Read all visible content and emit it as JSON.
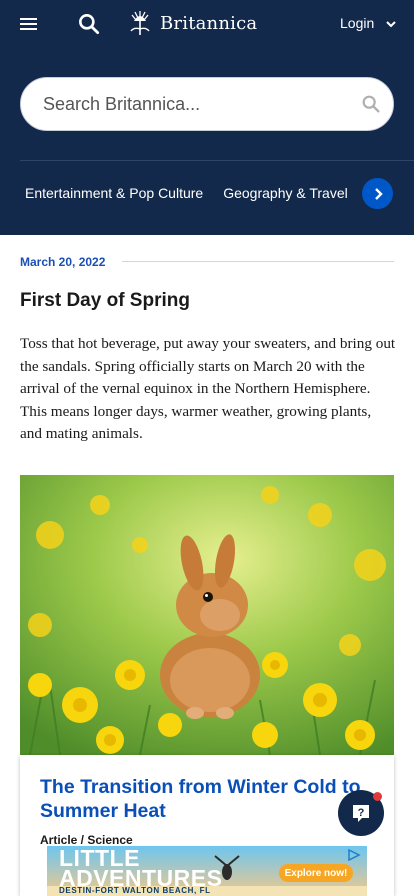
{
  "header": {
    "brand": "Britannica",
    "login_label": "Login",
    "icons": [
      "hamburger-menu-icon",
      "search-icon",
      "thistle-logo-icon",
      "chevron-down-icon"
    ]
  },
  "search": {
    "placeholder": "Search Britannica..."
  },
  "categories": {
    "items": [
      "Entertainment & Pop Culture",
      "Geography & Travel"
    ],
    "next_icon": "chevron-right-icon"
  },
  "article": {
    "date": "March 20, 2022",
    "title": "First Day of Spring",
    "body": "Toss that hot beverage, put away your sweaters, and bring out the sandals. Spring officially starts on March 20 with the arrival of the vernal equinox in the Northern Hemisphere. This means longer days, warmer weather, growing plants, and mating animals."
  },
  "card": {
    "title": "The Transition from Winter Cold to Summer Heat",
    "meta": "Article / Science",
    "image": "rabbit-in-dandelion-field"
  },
  "help": {
    "icon": "question-help-icon"
  },
  "ad": {
    "title": "LITTLE ADVENTURES",
    "subtitle": "DESTIN-FORT WALTON BEACH, FL",
    "cta": "Explore now!",
    "choice_icon": "adchoices-icon"
  },
  "colors": {
    "navy": "#13294b",
    "accent_blue": "#0057c8",
    "link_blue": "#0a4fb8",
    "alert_red": "#e03a3a"
  }
}
